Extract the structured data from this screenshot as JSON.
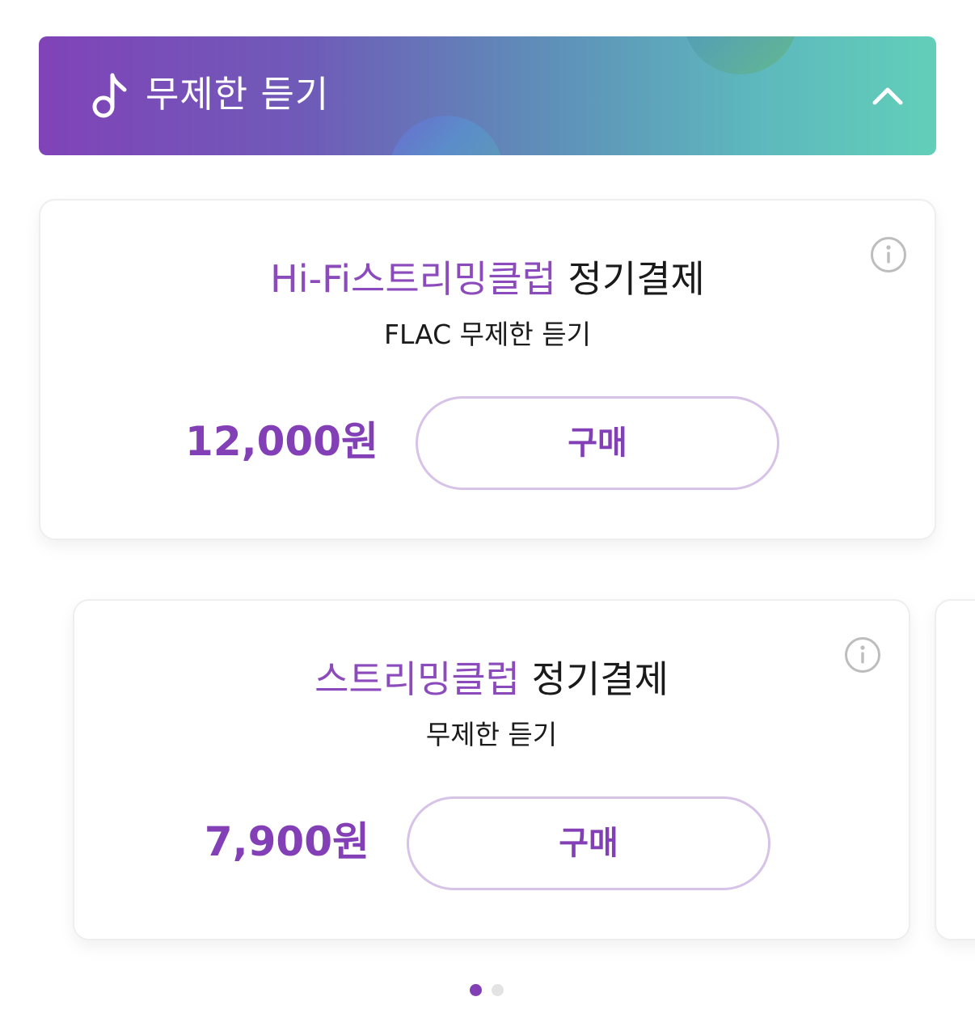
{
  "banner": {
    "title": "무제한 듣기",
    "note_icon": "music-note-icon",
    "collapse_icon": "chevron-up-icon",
    "gradient_start": "#8043b8",
    "gradient_end": "#62cfb9"
  },
  "plans": [
    {
      "title_accent": "Hi-Fi스트리밍클럽",
      "title_rest": " 정기결제",
      "subtitle": "FLAC 무제한 듣기",
      "price": "12,000원",
      "buy_label": "구매",
      "info_icon": "info-icon"
    },
    {
      "title_accent": "스트리밍클럽",
      "title_rest": " 정기결제",
      "subtitle": "무제한 듣기",
      "price": "7,900원",
      "buy_label": "구매",
      "info_icon": "info-icon"
    }
  ],
  "pager": {
    "active_index": 0,
    "count": 2
  },
  "colors": {
    "accent": "#8340b6",
    "button_border": "#d7c2e8",
    "text": "#1a1a1a"
  }
}
